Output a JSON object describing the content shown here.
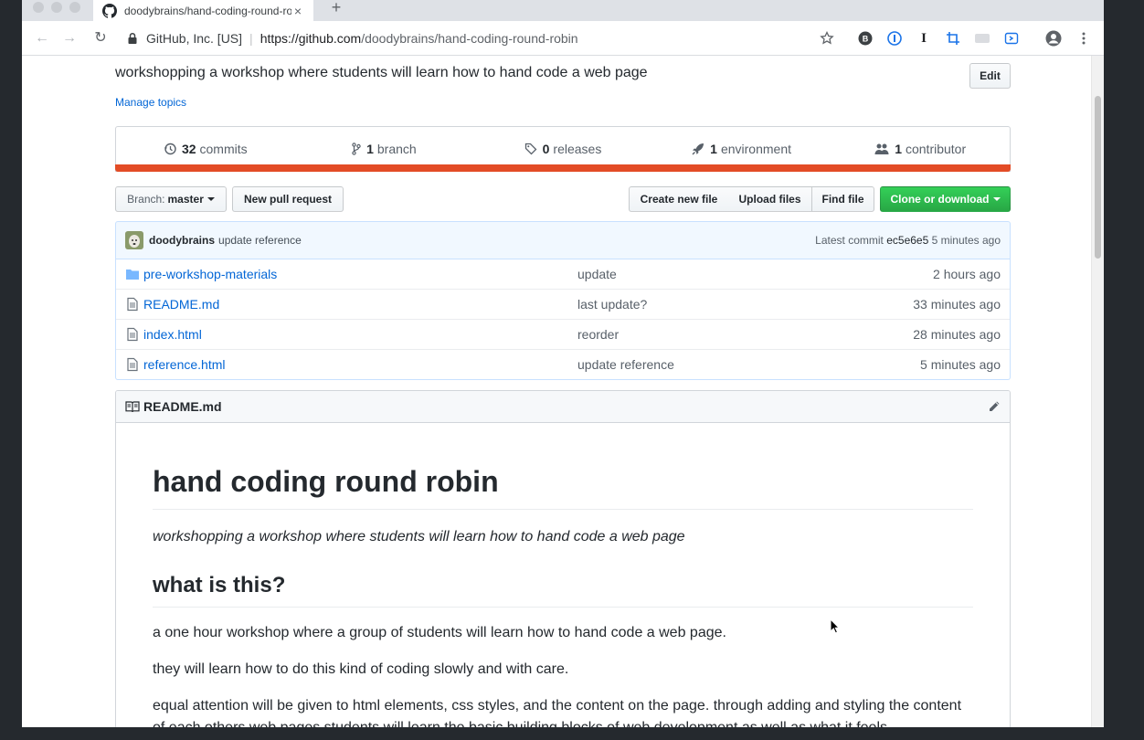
{
  "browser": {
    "tab_title": "doodybrains/hand-coding-round-robin",
    "tab_close": "×",
    "new_tab": "+",
    "org_label": "GitHub, Inc. [US]",
    "url_scheme_host": "https://github.com",
    "url_path": "/doodybrains/hand-coding-round-robin",
    "nav": {
      "back": "←",
      "forward": "→",
      "reload": "↻"
    },
    "extensions": [
      "star-icon",
      "extension-b-icon",
      "1password-icon",
      "instapaper-icon",
      "crop-icon",
      "extension-gray-icon",
      "extension-blue-icon",
      "profile-icon",
      "menu-icon"
    ]
  },
  "repo": {
    "description": "workshopping a workshop where students will learn how to hand code a web page",
    "edit_label": "Edit",
    "manage_topics": "Manage topics",
    "stats": [
      {
        "count": "32",
        "label": "commits",
        "icon": "history-icon"
      },
      {
        "count": "1",
        "label": "branch",
        "icon": "branch-icon"
      },
      {
        "count": "0",
        "label": "releases",
        "icon": "tag-icon"
      },
      {
        "count": "1",
        "label": "environment",
        "icon": "rocket-icon"
      },
      {
        "count": "1",
        "label": "contributor",
        "icon": "people-icon"
      }
    ],
    "language_color": "#e34c26"
  },
  "actions": {
    "branch_prefix": "Branch:",
    "branch_name": "master",
    "new_pull_request": "New pull request",
    "create_new_file": "Create new file",
    "upload_files": "Upload files",
    "find_file": "Find file",
    "clone_or_download": "Clone or download"
  },
  "latest_commit": {
    "author": "doodybrains",
    "message": "update reference",
    "prefix": "Latest commit",
    "sha": "ec5e6e5",
    "age": "5 minutes ago"
  },
  "files": [
    {
      "name": "pre-workshop-materials",
      "type": "folder",
      "message": "update",
      "age": "2 hours ago"
    },
    {
      "name": "README.md",
      "type": "file",
      "message": "last update?",
      "age": "33 minutes ago"
    },
    {
      "name": "index.html",
      "type": "file",
      "message": "reorder",
      "age": "28 minutes ago"
    },
    {
      "name": "reference.html",
      "type": "file",
      "message": "update reference",
      "age": "5 minutes ago"
    }
  ],
  "readme": {
    "filename": "README.md",
    "h1": "hand coding round robin",
    "lead": "workshopping a workshop where students will learn how to hand code a web page",
    "h2": "what is this?",
    "p1": "a one hour workshop where a group of students will learn how to hand code a web page.",
    "p2": "they will learn how to do this kind of coding slowly and with care.",
    "p3": "equal attention will be given to html elements, css styles, and the content on the page. through adding and styling the content of each others web pages students will learn the basic building blocks of web development as well as what it feels"
  }
}
